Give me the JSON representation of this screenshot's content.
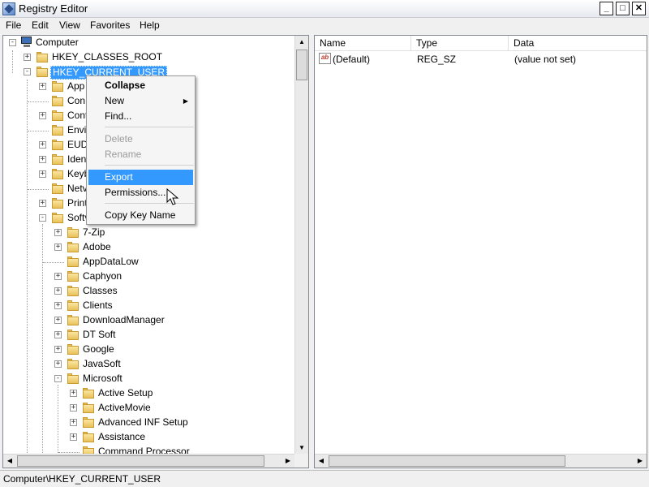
{
  "window": {
    "title": "Registry Editor"
  },
  "menu": [
    "File",
    "Edit",
    "View",
    "Favorites",
    "Help"
  ],
  "tree": {
    "root": "Computer",
    "hives": [
      "HKEY_CLASSES_ROOT",
      "HKEY_CURRENT_USER"
    ],
    "hkcu_children": [
      "App",
      "Con",
      "Cont",
      "Envi",
      "EUD",
      "Iden",
      "Keyb",
      "Netv",
      "Print",
      "Softv"
    ],
    "software_children": [
      "7-Zip",
      "Adobe",
      "AppDataLow",
      "Caphyon",
      "Classes",
      "Clients",
      "DownloadManager",
      "DT Soft",
      "Google",
      "JavaSoft",
      "Microsoft"
    ],
    "microsoft_children": [
      "Active Setup",
      "ActiveMovie",
      "Advanced INF Setup",
      "Assistance",
      "Command Processor"
    ]
  },
  "list": {
    "columns": [
      "Name",
      "Type",
      "Data"
    ],
    "rows": [
      {
        "name": "(Default)",
        "type": "REG_SZ",
        "data": "(value not set)"
      }
    ]
  },
  "context_menu": {
    "items": [
      "Collapse",
      "New",
      "Find...",
      "Delete",
      "Rename",
      "Export",
      "Permissions...",
      "Copy Key Name"
    ],
    "highlighted": "Export",
    "disabled": [
      "Delete",
      "Rename"
    ]
  },
  "status": "Computer\\HKEY_CURRENT_USER"
}
